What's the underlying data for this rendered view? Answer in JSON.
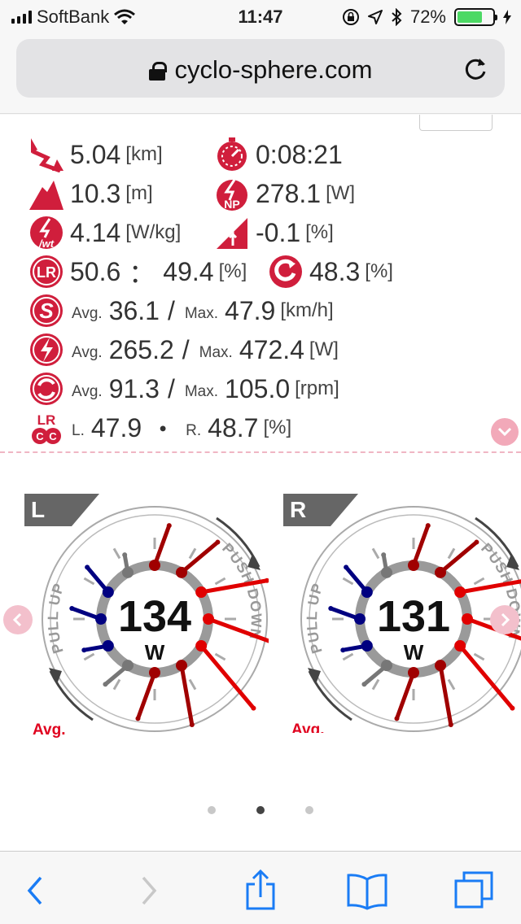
{
  "status_bar": {
    "carrier": "SoftBank",
    "time": "11:47",
    "battery": "72%",
    "battery_level": 0.72,
    "icons": [
      "signal-icon",
      "wifi-icon",
      "orientation-lock-icon",
      "location-icon",
      "bluetooth-icon",
      "battery-icon",
      "charging-icon"
    ]
  },
  "browser": {
    "url": "cyclo-sphere.com",
    "icons": [
      "lock-icon",
      "reload-icon"
    ]
  },
  "stats": {
    "distance": {
      "value": "5.04",
      "unit": "[km]",
      "icon": "distance-icon"
    },
    "time": {
      "value": "0:08:21",
      "icon": "stopwatch-icon"
    },
    "elevation": {
      "value": "10.3",
      "unit": "[m]",
      "icon": "elevation-icon"
    },
    "np": {
      "value": "278.1",
      "unit": "[W]",
      "icon": "normalized-power-icon"
    },
    "wkg": {
      "value": "4.14",
      "unit": "[W/kg]",
      "icon": "power-weight-icon"
    },
    "grade": {
      "value": "-0.1",
      "unit": "[%]",
      "icon": "grade-icon"
    },
    "lr_balance": {
      "left": "50.6",
      "sep": "：",
      "right": "49.4",
      "unit": "[%]",
      "icon": "lr-balance-icon"
    },
    "efficiency": {
      "value": "48.3",
      "unit": "[%]",
      "icon": "pedal-efficiency-icon"
    },
    "speed": {
      "avg_label": "Avg.",
      "avg": "36.1",
      "slash": "/",
      "max_label": "Max.",
      "max": "47.9",
      "unit": "[km/h]",
      "icon": "speed-icon"
    },
    "power": {
      "avg_label": "Avg.",
      "avg": "265.2",
      "slash": "/",
      "max_label": "Max.",
      "max": "472.4",
      "unit": "[W]",
      "icon": "power-icon"
    },
    "cadence": {
      "avg_label": "Avg.",
      "avg": "91.3",
      "slash": "/",
      "max_label": "Max.",
      "max": "105.0",
      "unit": "[rpm]",
      "icon": "cadence-icon"
    },
    "lr_cc": {
      "l_label": "L.",
      "left": "47.9",
      "dot": "・",
      "r_label": "R.",
      "right": "48.7",
      "unit": "[%]",
      "icon": "lr-cc-icon"
    }
  },
  "gauges": [
    {
      "side": "L",
      "power": "134",
      "unit": "W",
      "arc_top": "PULL UP",
      "arc_right": "PUSH DOWN",
      "avg_label": "Avg."
    },
    {
      "side": "R",
      "power": "131",
      "unit": "W",
      "arc_top": "PULL UP",
      "arc_right": "PUSH DOWN",
      "avg_label": "Avg."
    }
  ],
  "pager": {
    "count": 3,
    "active": 1
  },
  "toolbar": {
    "icons": [
      "back-icon",
      "forward-icon",
      "share-icon",
      "bookmarks-icon",
      "tabs-icon"
    ]
  },
  "colors": {
    "accent": "#c8102e",
    "pink": "#e8325a",
    "vector_red": "#e00000",
    "vector_darkred": "#a00000",
    "vector_blue": "#000080",
    "gray": "#999999"
  }
}
